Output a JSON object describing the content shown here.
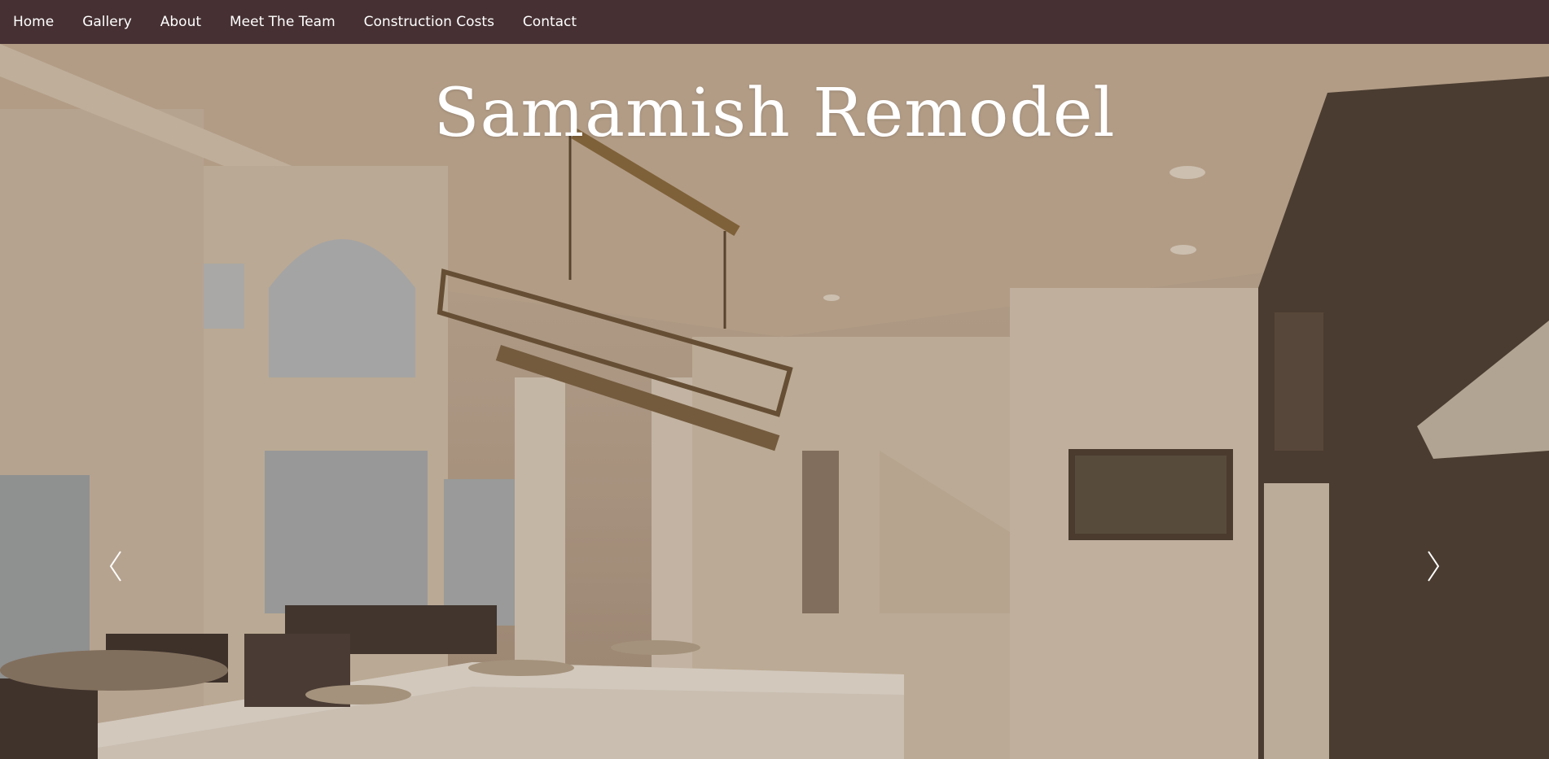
{
  "nav": {
    "items": [
      {
        "label": "Home"
      },
      {
        "label": "Gallery"
      },
      {
        "label": "About"
      },
      {
        "label": "Meet The Team"
      },
      {
        "label": "Construction Costs"
      },
      {
        "label": "Contact"
      }
    ]
  },
  "hero": {
    "title": "Samamish Remodel",
    "prev_icon": "chevron-left-icon",
    "next_icon": "chevron-right-icon"
  },
  "colors": {
    "nav_background": "#463033",
    "nav_text": "#ffffff",
    "title_text": "#ffffff"
  }
}
